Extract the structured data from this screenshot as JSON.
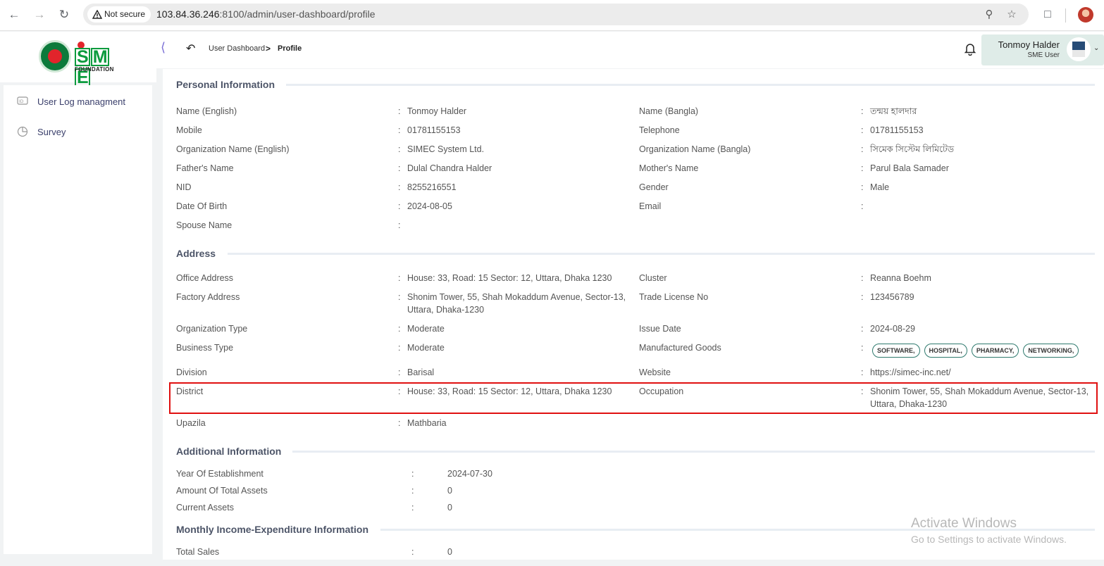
{
  "browser": {
    "security_label": "Not secure",
    "url_host": "103.84.36.246",
    "url_rest": ":8100/admin/user-dashboard/profile"
  },
  "sidebar": {
    "items": [
      {
        "label": "User Log managment",
        "icon": "id-card-icon"
      },
      {
        "label": "Survey",
        "icon": "pie-chart-icon"
      }
    ],
    "logo_text": "SME",
    "logo_subtext": "FOUNDATION"
  },
  "breadcrumb": {
    "home": "User Dashboard",
    "separator": ">",
    "current": "Profile"
  },
  "user": {
    "name": "Tonmoy Halder",
    "role": "SME User"
  },
  "personal": {
    "title": "Personal Information",
    "rows": [
      {
        "l1": "Name (English)",
        "v1": "Tonmoy Halder",
        "l2": "Name (Bangla)",
        "v2": "তন্ময় হালদার"
      },
      {
        "l1": "Mobile",
        "v1": "01781155153",
        "l2": "Telephone",
        "v2": "01781155153"
      },
      {
        "l1": "Organization Name (English)",
        "v1": "SIMEC System Ltd.",
        "l2": "Organization Name (Bangla)",
        "v2": "সিমেক সিস্টেম লিমিটেড"
      },
      {
        "l1": "Father's Name",
        "v1": "Dulal Chandra Halder",
        "l2": "Mother's Name",
        "v2": "Parul Bala Samader"
      },
      {
        "l1": "NID",
        "v1": "8255216551",
        "l2": "Gender",
        "v2": "Male"
      },
      {
        "l1": "Date Of Birth",
        "v1": "2024-08-05",
        "l2": "Email",
        "v2": ""
      },
      {
        "l1": "Spouse Name",
        "v1": ""
      }
    ]
  },
  "address": {
    "title": "Address",
    "rows": [
      {
        "l1": "Office Address",
        "v1": "House: 33, Road: 15 Sector: 12, Uttara, Dhaka 1230",
        "l2": "Cluster",
        "v2": "Reanna Boehm"
      },
      {
        "l1": "Factory Address",
        "v1a": "Shonim Tower, 55, Shah Mokaddum Avenue, Sector-13,",
        "v1b": "Uttara, Dhaka-1230",
        "l2": "Trade License No",
        "v2": "123456789"
      },
      {
        "l1": "Organization Type",
        "v1": "Moderate",
        "l2": "Issue Date",
        "v2": "2024-08-29"
      },
      {
        "l1": "Business Type",
        "v1": "Moderate",
        "l2": "Manufactured Goods"
      },
      {
        "l1": "Division",
        "v1": "Barisal",
        "l2": "Website",
        "v2": "https://simec-inc.net/"
      },
      {
        "l1": "District",
        "v1": "House: 33, Road: 15 Sector: 12, Uttara, Dhaka 1230",
        "l2": "Occupation",
        "v2a": "Shonim Tower, 55, Shah Mokaddum Avenue, Sector-13,",
        "v2b": "Uttara, Dhaka-1230"
      },
      {
        "l1": "Upazila",
        "v1": "Mathbaria"
      }
    ],
    "goods": [
      "SOFTWARE,",
      "HOSPITAL,",
      "PHARMACY,",
      "NETWORKING,"
    ]
  },
  "additional": {
    "title": "Additional Information",
    "rows": [
      {
        "l": "Year Of Establishment",
        "v": "2024-07-30"
      },
      {
        "l": "Amount Of Total Assets",
        "v": "0"
      },
      {
        "l": "Current Assets",
        "v": "0"
      }
    ]
  },
  "monthly": {
    "title": "Monthly Income-Expenditure Information",
    "rows": [
      {
        "l": "Total Sales",
        "v": "0"
      }
    ]
  },
  "colon": ":",
  "watermark": {
    "line1": "Activate Windows",
    "line2": "Go to Settings to activate Windows."
  },
  "colors": {
    "accent": "#7b6fd6",
    "highlight": "#e01010",
    "chip_border": "#2f7a6e",
    "user_box": "#dfece8"
  }
}
